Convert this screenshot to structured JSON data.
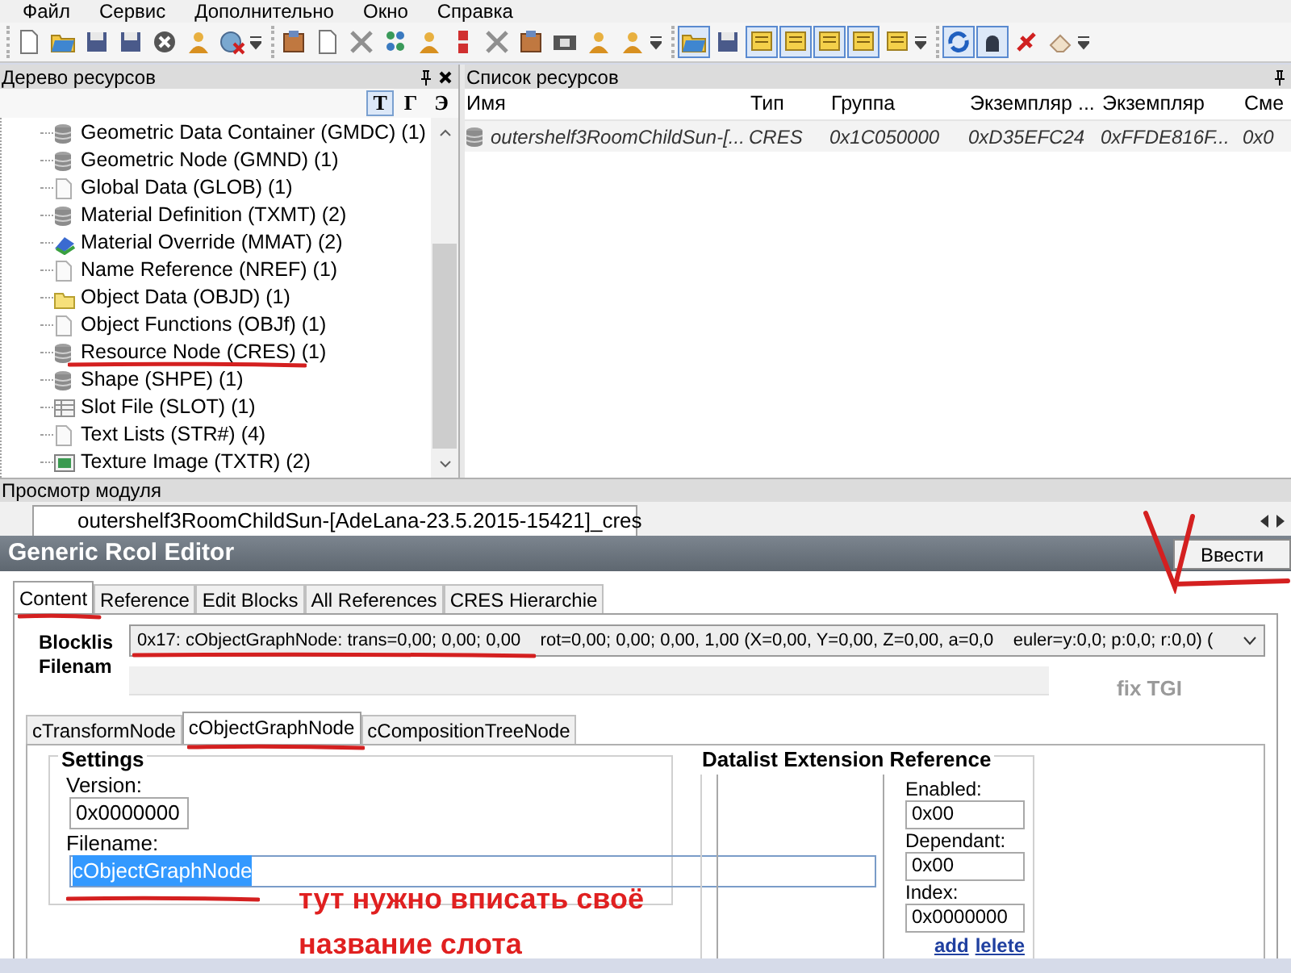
{
  "menu": [
    {
      "label": "Файл"
    },
    {
      "label": "Сервис"
    },
    {
      "label": "Дополнительно"
    },
    {
      "label": "Окно"
    },
    {
      "label": "Справка"
    }
  ],
  "toolbar": {
    "groups": [
      [
        {
          "pressed": false
        },
        {
          "pressed": false
        },
        {
          "pressed": false
        },
        {
          "pressed": false
        },
        {
          "pressed": false
        },
        {
          "pressed": false
        },
        {
          "pressed": false
        }
      ],
      [
        {
          "pressed": false
        },
        {
          "pressed": false
        },
        {
          "pressed": false
        },
        {
          "pressed": false
        },
        {
          "pressed": false
        },
        {
          "pressed": false
        },
        {
          "pressed": false
        },
        {
          "pressed": false
        },
        {
          "pressed": false
        },
        {
          "pressed": false
        },
        {
          "pressed": false
        }
      ],
      [
        {
          "pressed": true
        },
        {
          "pressed": false
        },
        {
          "pressed": true
        },
        {
          "pressed": true
        },
        {
          "pressed": true
        },
        {
          "pressed": true
        },
        {
          "pressed": false
        }
      ],
      [
        {
          "pressed": true
        },
        {
          "pressed": true
        },
        {
          "pressed": false
        },
        {
          "pressed": false
        }
      ]
    ]
  },
  "resource_tree": {
    "title": "Дерево ресурсов",
    "view_buttons": [
      {
        "label": "T",
        "selected": true
      },
      {
        "label": "Г",
        "selected": false
      },
      {
        "label": "Э",
        "selected": false
      }
    ],
    "items": [
      {
        "label": "Geometric Data Container (GMDC) (1)",
        "kind": "database",
        "underlined": false
      },
      {
        "label": "Geometric Node (GMND) (1)",
        "kind": "database",
        "underlined": false
      },
      {
        "label": "Global Data (GLOB) (1)",
        "kind": "document",
        "underlined": false
      },
      {
        "label": "Material Definition (TXMT) (2)",
        "kind": "database",
        "underlined": false
      },
      {
        "label": "Material Override (MMAT) (2)",
        "kind": "material",
        "underlined": false
      },
      {
        "label": "Name Reference (NREF) (1)",
        "kind": "document",
        "underlined": false
      },
      {
        "label": "Object Data (OBJD) (1)",
        "kind": "folder",
        "underlined": false
      },
      {
        "label": "Object Functions (OBJf) (1)",
        "kind": "document",
        "underlined": false
      },
      {
        "label": "Resource Node (CRES) (1)",
        "kind": "database",
        "underlined": true
      },
      {
        "label": "Shape (SHPE) (1)",
        "kind": "database",
        "underlined": false
      },
      {
        "label": "Slot File (SLOT) (1)",
        "kind": "table",
        "underlined": false
      },
      {
        "label": "Text Lists (STR#) (4)",
        "kind": "document",
        "underlined": false
      },
      {
        "label": "Texture Image (TXTR) (2)",
        "kind": "image",
        "underlined": false
      }
    ]
  },
  "resource_list": {
    "title": "Список ресурсов",
    "columns": [
      "Имя",
      "Тип",
      "Группа",
      "Экземпляр ...",
      "Экземпляр",
      "Сме"
    ],
    "rows": [
      {
        "kind": "database",
        "cells": [
          "outershelf3RoomChildSun-[...",
          "CRES",
          "0x1C050000",
          "0xD35EFC24",
          "0xFFDE816F...",
          "0x0"
        ]
      }
    ]
  },
  "module_view": {
    "title": "Просмотр модуля",
    "document_tab": "outershelf3RoomChildSun-[AdeLana-23.5.2015-15421]_cres",
    "editor": {
      "title": "Generic Rcol Editor",
      "commit_button": "Ввести",
      "tabs": [
        {
          "label": "Content",
          "selected": true,
          "underlined": true
        },
        {
          "label": "Reference",
          "selected": false,
          "underlined": false
        },
        {
          "label": "Edit Blocks",
          "selected": false,
          "underlined": false
        },
        {
          "label": "All References",
          "selected": false,
          "underlined": false
        },
        {
          "label": "CRES Hierarchie",
          "selected": false,
          "underlined": false
        }
      ],
      "blocklist_label": "Blocklis",
      "blocklist_value": "0x17: cObjectGraphNode: trans=0,00; 0,00; 0,00    rot=0,00; 0,00; 0,00, 1,00 (X=0,00, Y=0,00, Z=0,00, a=0,0    euler=y:0,0; p:0,0; r:0,0) (",
      "blocklist_underlined": true,
      "filename_label": "Filenam",
      "fix_tgi": "fix TGI",
      "block_tabs": [
        {
          "label": "cTransformNode",
          "selected": false,
          "underlined": false
        },
        {
          "label": "cObjectGraphNode",
          "selected": true,
          "underlined": true
        },
        {
          "label": "cCompositionTreeNode",
          "selected": false,
          "underlined": false
        }
      ],
      "settings": {
        "title": "Settings",
        "version_label": "Version:",
        "version": "0x0000000",
        "filename_label": "Filename:",
        "filename": "cObjectGraphNode",
        "filename_selected": true,
        "filename_underlined": true
      },
      "datalist": {
        "title": "Datalist Extension Reference",
        "enabled_label": "Enabled:",
        "enabled": "0x00",
        "dependant_label": "Dependant:",
        "dependant": "0x00",
        "index_label": "Index:",
        "index": "0x0000000",
        "links": [
          "add",
          "lelete"
        ]
      }
    }
  },
  "annotation": {
    "lines": [
      "тут нужно вписать своё",
      "название слота"
    ],
    "checkmark": true
  }
}
